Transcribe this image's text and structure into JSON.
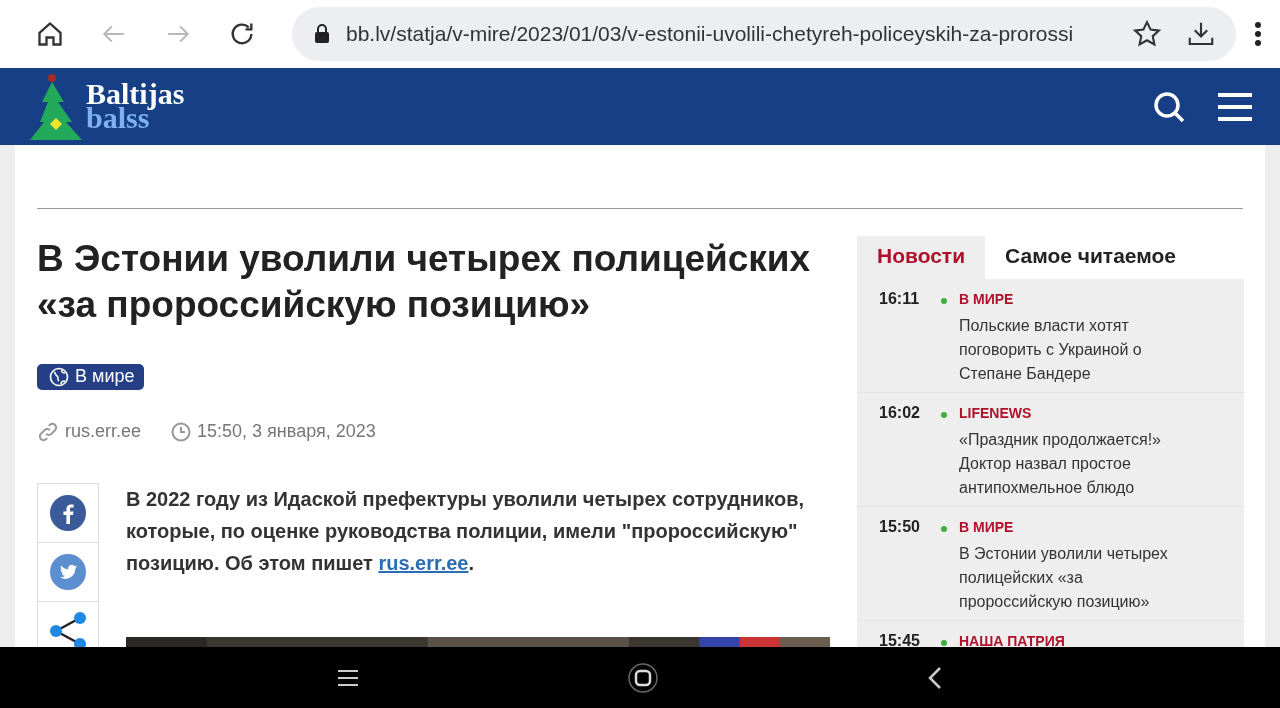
{
  "browser": {
    "url": "bb.lv/statja/v-mire/2023/01/03/v-estonii-uvolili-chetyreh-policeyskih-za-prorossi",
    "back_disabled": true,
    "forward_disabled": true
  },
  "site_header": {
    "logo_top": "Baltijas",
    "logo_bottom": "balss"
  },
  "article": {
    "title": "В Эстонии уволили четырех полицейских «за пророссийскую позицию»",
    "rubric": "В мире",
    "source": "rus.err.ee",
    "date": "15:50, 3 января, 2023",
    "lead_before": "В 2022 году из Идаской префектуры уволили четырех сотрудников, которые, по оценке руководства полиции, имели \"пророссийскую\" позицию. Об этом пишет ",
    "lead_link": "rus.err.ee",
    "lead_after": ".",
    "share": [
      {
        "kind": "facebook"
      },
      {
        "kind": "twitter"
      },
      {
        "kind": "share"
      }
    ]
  },
  "sidebar": {
    "tabs": [
      {
        "label": "Новости",
        "selected": true
      },
      {
        "label": "Самое читаемое",
        "selected": false
      }
    ],
    "items": [
      {
        "time": "16:11",
        "category": "В МИРЕ",
        "headline": "Польские власти хотят поговорить с Украиной о Степане Бандере"
      },
      {
        "time": "16:02",
        "category": "LIFENEWS",
        "headline": "«Праздник продолжается!» Доктор назвал простое антипохмельное блюдо"
      },
      {
        "time": "15:50",
        "category": "В МИРЕ",
        "headline": "В Эстонии уволили четырех полицейских «за пророссийскую позицию»"
      },
      {
        "time": "15:45",
        "category": "НАША ПАТРИЯ"
      }
    ]
  }
}
